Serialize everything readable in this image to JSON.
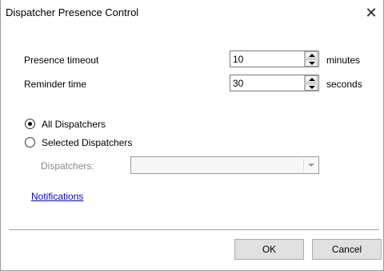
{
  "window": {
    "title": "Dispatcher Presence Control"
  },
  "presence_timeout": {
    "label": "Presence timeout",
    "value": "10",
    "unit": "minutes"
  },
  "reminder_time": {
    "label": "Reminder time",
    "value": "30",
    "unit": "seconds"
  },
  "radios": {
    "all": {
      "label": "All Dispatchers",
      "selected": true
    },
    "selected": {
      "label": "Selected Dispatchers",
      "selected": false
    }
  },
  "dispatchers": {
    "label": "Dispatchers:",
    "value": ""
  },
  "notifications_link": "Notifications",
  "buttons": {
    "ok": "OK",
    "cancel": "Cancel"
  },
  "icons": {
    "close": "close-icon"
  }
}
